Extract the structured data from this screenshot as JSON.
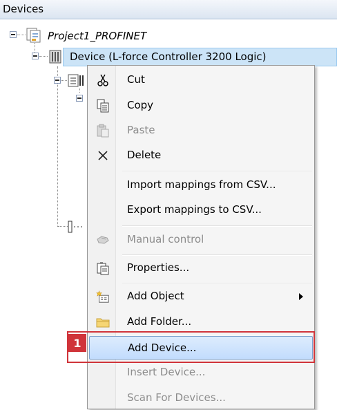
{
  "panel": {
    "title": "Devices"
  },
  "tree": {
    "project_label": "Project1_PROFINET",
    "device_label": "Device (L-force Controller 3200 Logic)"
  },
  "menu": {
    "items": [
      {
        "label": "Cut",
        "icon": "scissors-icon",
        "enabled": true
      },
      {
        "label": "Copy",
        "icon": "copy-icon",
        "enabled": true
      },
      {
        "label": "Paste",
        "icon": "paste-icon",
        "enabled": false
      },
      {
        "label": "Delete",
        "icon": "delete-icon",
        "enabled": true
      },
      {
        "label": "Import mappings from CSV...",
        "icon": "",
        "enabled": true
      },
      {
        "label": "Export mappings to CSV...",
        "icon": "",
        "enabled": true
      },
      {
        "label": "Manual control",
        "icon": "manual-control-icon",
        "enabled": false
      },
      {
        "label": "Properties...",
        "icon": "properties-icon",
        "enabled": true
      },
      {
        "label": "Add Object",
        "icon": "add-object-icon",
        "enabled": true,
        "submenu": true
      },
      {
        "label": "Add Folder...",
        "icon": "folder-icon",
        "enabled": true
      },
      {
        "label": "Add Device...",
        "icon": "",
        "enabled": true,
        "highlighted": true
      },
      {
        "label": "Insert Device...",
        "icon": "",
        "enabled": false
      },
      {
        "label": "Scan For Devices...",
        "icon": "",
        "enabled": false
      }
    ]
  },
  "callout": {
    "number": "1",
    "color": "#d0343a"
  }
}
